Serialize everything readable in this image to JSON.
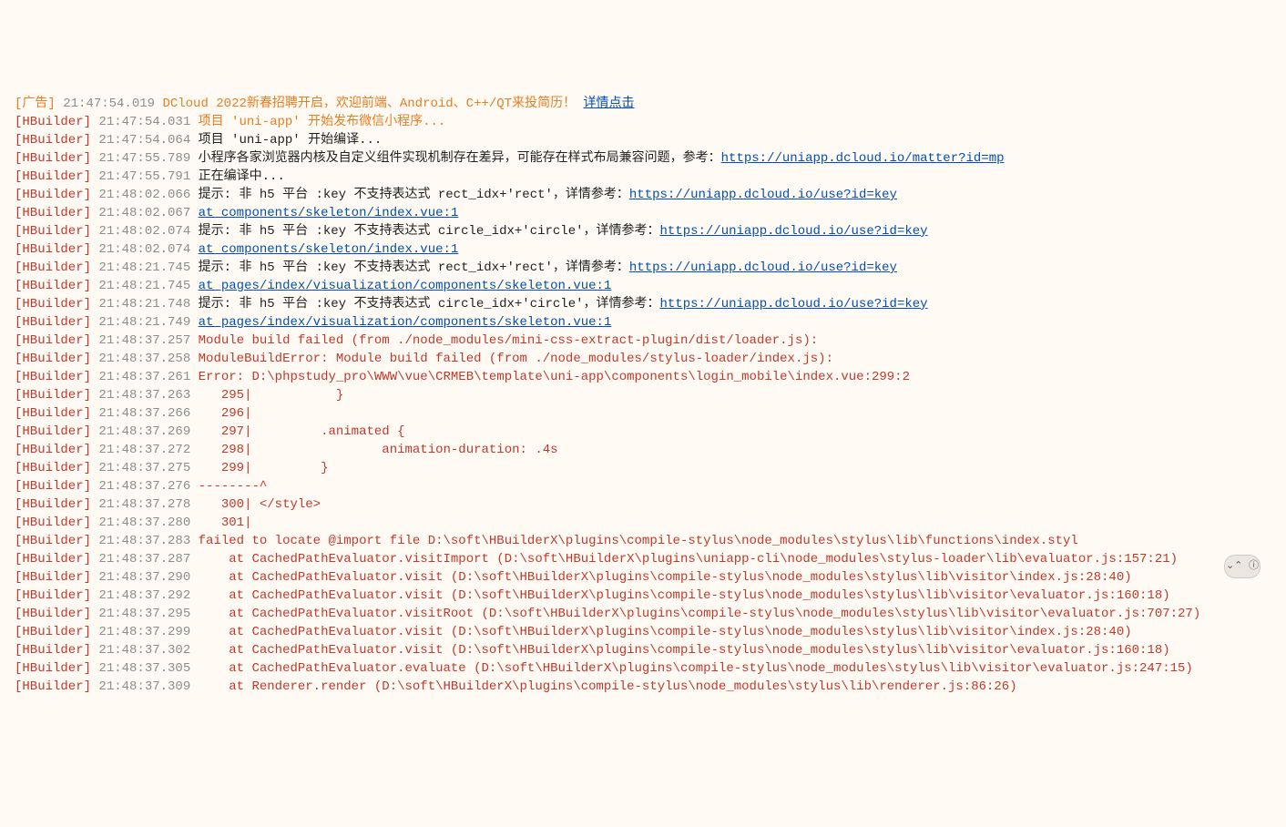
{
  "console": {
    "lines": [
      {
        "tag": "[广告]",
        "tagClass": "tag-ad",
        "ts": "21:47:54.019",
        "segments": [
          {
            "text": "DCloud 2022新春招聘开启，欢迎前端、Android、C++/QT来投简历！",
            "class": "body-orange"
          },
          {
            "text": " ",
            "class": "body-black"
          },
          {
            "text": "详情点击",
            "class": "link",
            "interact": true
          }
        ]
      },
      {
        "tag": "[HBuilder]",
        "tagClass": "tag",
        "ts": "21:47:54.031",
        "segments": [
          {
            "text": "项目 'uni-app' 开始发布微信小程序...",
            "class": "body-orange"
          }
        ]
      },
      {
        "tag": "[HBuilder]",
        "tagClass": "tag",
        "ts": "21:47:54.064",
        "segments": [
          {
            "text": "项目 'uni-app' 开始编译...",
            "class": "body-black"
          }
        ]
      },
      {
        "tag": "[HBuilder]",
        "tagClass": "tag",
        "ts": "21:47:55.789",
        "segments": [
          {
            "text": "小程序各家浏览器内核及自定义组件实现机制存在差异，可能存在样式布局兼容问题，参考：",
            "class": "body-black"
          },
          {
            "text": "https://uniapp.dcloud.io/matter?id=mp",
            "class": "link",
            "interact": true
          }
        ]
      },
      {
        "tag": "[HBuilder]",
        "tagClass": "tag",
        "ts": "21:47:55.791",
        "segments": [
          {
            "text": "正在编译中...",
            "class": "body-black"
          }
        ]
      },
      {
        "tag": "[HBuilder]",
        "tagClass": "tag",
        "ts": "21:48:02.066",
        "segments": [
          {
            "text": "提示: 非 h5 平台 :key 不支持表达式 rect_idx+'rect'，详情参考：",
            "class": "body-black"
          },
          {
            "text": "https://uniapp.dcloud.io/use?id=key",
            "class": "link",
            "interact": true
          }
        ]
      },
      {
        "tag": "[HBuilder]",
        "tagClass": "tag",
        "ts": "21:48:02.067",
        "segments": [
          {
            "text": "at components/skeleton/index.vue:1",
            "class": "link",
            "interact": true
          }
        ]
      },
      {
        "tag": "[HBuilder]",
        "tagClass": "tag",
        "ts": "21:48:02.074",
        "segments": [
          {
            "text": "提示: 非 h5 平台 :key 不支持表达式 circle_idx+'circle'，详情参考：",
            "class": "body-black"
          },
          {
            "text": "https://uniapp.dcloud.io/use?id=key",
            "class": "link",
            "interact": true
          }
        ]
      },
      {
        "tag": "[HBuilder]",
        "tagClass": "tag",
        "ts": "21:48:02.074",
        "segments": [
          {
            "text": "at components/skeleton/index.vue:1",
            "class": "link",
            "interact": true
          }
        ]
      },
      {
        "tag": "[HBuilder]",
        "tagClass": "tag",
        "ts": "21:48:21.745",
        "segments": [
          {
            "text": "提示: 非 h5 平台 :key 不支持表达式 rect_idx+'rect'，详情参考：",
            "class": "body-black"
          },
          {
            "text": "https://uniapp.dcloud.io/use?id=key",
            "class": "link",
            "interact": true
          }
        ]
      },
      {
        "tag": "[HBuilder]",
        "tagClass": "tag",
        "ts": "21:48:21.745",
        "segments": [
          {
            "text": "at pages/index/visualization/components/skeleton.vue:1",
            "class": "link",
            "interact": true
          }
        ]
      },
      {
        "tag": "[HBuilder]",
        "tagClass": "tag",
        "ts": "21:48:21.748",
        "segments": [
          {
            "text": "提示: 非 h5 平台 :key 不支持表达式 circle_idx+'circle'，详情参考：",
            "class": "body-black"
          },
          {
            "text": "https://uniapp.dcloud.io/use?id=key",
            "class": "link",
            "interact": true
          }
        ]
      },
      {
        "tag": "[HBuilder]",
        "tagClass": "tag",
        "ts": "21:48:21.749",
        "segments": [
          {
            "text": "at pages/index/visualization/components/skeleton.vue:1",
            "class": "link",
            "interact": true
          }
        ]
      },
      {
        "tag": "[HBuilder]",
        "tagClass": "tag",
        "ts": "21:48:37.257",
        "segments": [
          {
            "text": "Module build failed (from ./node_modules/mini-css-extract-plugin/dist/loader.js):",
            "class": "body-red"
          }
        ]
      },
      {
        "tag": "[HBuilder]",
        "tagClass": "tag",
        "ts": "21:48:37.258",
        "segments": [
          {
            "text": "ModuleBuildError: Module build failed (from ./node_modules/stylus-loader/index.js):",
            "class": "body-red"
          }
        ]
      },
      {
        "tag": "[HBuilder]",
        "tagClass": "tag",
        "ts": "21:48:37.261",
        "segments": [
          {
            "text": "Error: D:\\phpstudy_pro\\WWW\\vue\\CRMEB\\template\\uni-app\\components\\login_mobile\\index.vue:299:2",
            "class": "body-red"
          }
        ]
      },
      {
        "tag": "[HBuilder]",
        "tagClass": "tag",
        "ts": "21:48:37.263",
        "segments": [
          {
            "text": "   295|           }",
            "class": "body-red"
          }
        ]
      },
      {
        "tag": "[HBuilder]",
        "tagClass": "tag",
        "ts": "21:48:37.266",
        "segments": [
          {
            "text": "   296| ",
            "class": "body-red"
          }
        ]
      },
      {
        "tag": "[HBuilder]",
        "tagClass": "tag",
        "ts": "21:48:37.269",
        "segments": [
          {
            "text": "   297|         .animated {",
            "class": "body-red"
          }
        ]
      },
      {
        "tag": "[HBuilder]",
        "tagClass": "tag",
        "ts": "21:48:37.272",
        "segments": [
          {
            "text": "   298|                 animation-duration: .4s",
            "class": "body-red"
          }
        ]
      },
      {
        "tag": "[HBuilder]",
        "tagClass": "tag",
        "ts": "21:48:37.275",
        "segments": [
          {
            "text": "   299|         }",
            "class": "body-red"
          }
        ]
      },
      {
        "tag": "[HBuilder]",
        "tagClass": "tag",
        "ts": "21:48:37.276",
        "segments": [
          {
            "text": "--------^",
            "class": "body-red"
          }
        ]
      },
      {
        "tag": "[HBuilder]",
        "tagClass": "tag",
        "ts": "21:48:37.278",
        "segments": [
          {
            "text": "   300| </style>",
            "class": "body-red"
          }
        ]
      },
      {
        "tag": "[HBuilder]",
        "tagClass": "tag",
        "ts": "21:48:37.280",
        "segments": [
          {
            "text": "   301| ",
            "class": "body-red"
          }
        ]
      },
      {
        "tag": "[HBuilder]",
        "tagClass": "tag",
        "ts": "21:48:37.283",
        "segments": [
          {
            "text": "failed to locate @import file D:\\soft\\HBuilderX\\plugins\\compile-stylus\\node_modules\\stylus\\lib\\functions\\index.styl",
            "class": "body-red"
          }
        ]
      },
      {
        "tag": "[HBuilder]",
        "tagClass": "tag",
        "ts": "21:48:37.287",
        "segments": [
          {
            "text": "    at CachedPathEvaluator.visitImport (D:\\soft\\HBuilderX\\plugins\\uniapp-cli\\node_modules\\stylus-loader\\lib\\evaluator.js:157:21)",
            "class": "body-red"
          }
        ]
      },
      {
        "tag": "[HBuilder]",
        "tagClass": "tag",
        "ts": "21:48:37.290",
        "segments": [
          {
            "text": "    at CachedPathEvaluator.visit (D:\\soft\\HBuilderX\\plugins\\compile-stylus\\node_modules\\stylus\\lib\\visitor\\index.js:28:40)",
            "class": "body-red"
          }
        ]
      },
      {
        "tag": "[HBuilder]",
        "tagClass": "tag",
        "ts": "21:48:37.292",
        "segments": [
          {
            "text": "    at CachedPathEvaluator.visit (D:\\soft\\HBuilderX\\plugins\\compile-stylus\\node_modules\\stylus\\lib\\visitor\\evaluator.js:160:18)",
            "class": "body-red"
          }
        ]
      },
      {
        "tag": "[HBuilder]",
        "tagClass": "tag",
        "ts": "21:48:37.295",
        "segments": [
          {
            "text": "    at CachedPathEvaluator.visitRoot (D:\\soft\\HBuilderX\\plugins\\compile-stylus\\node_modules\\stylus\\lib\\visitor\\evaluator.js:707:27)",
            "class": "body-red"
          }
        ]
      },
      {
        "tag": "[HBuilder]",
        "tagClass": "tag",
        "ts": "21:48:37.299",
        "segments": [
          {
            "text": "    at CachedPathEvaluator.visit (D:\\soft\\HBuilderX\\plugins\\compile-stylus\\node_modules\\stylus\\lib\\visitor\\index.js:28:40)",
            "class": "body-red"
          }
        ]
      },
      {
        "tag": "[HBuilder]",
        "tagClass": "tag",
        "ts": "21:48:37.302",
        "segments": [
          {
            "text": "    at CachedPathEvaluator.visit (D:\\soft\\HBuilderX\\plugins\\compile-stylus\\node_modules\\stylus\\lib\\visitor\\evaluator.js:160:18)",
            "class": "body-red"
          }
        ]
      },
      {
        "tag": "[HBuilder]",
        "tagClass": "tag",
        "ts": "21:48:37.305",
        "segments": [
          {
            "text": "    at CachedPathEvaluator.evaluate (D:\\soft\\HBuilderX\\plugins\\compile-stylus\\node_modules\\stylus\\lib\\visitor\\evaluator.js:247:15)",
            "class": "body-red"
          }
        ]
      },
      {
        "tag": "[HBuilder]",
        "tagClass": "tag",
        "ts": "21:48:37.309",
        "segments": [
          {
            "text": "    at Renderer.render (D:\\soft\\HBuilderX\\plugins\\compile-stylus\\node_modules\\stylus\\lib\\renderer.js:86:26)",
            "class": "body-red"
          }
        ]
      }
    ]
  },
  "float_button_label": "⌄⌃ ⓘ"
}
